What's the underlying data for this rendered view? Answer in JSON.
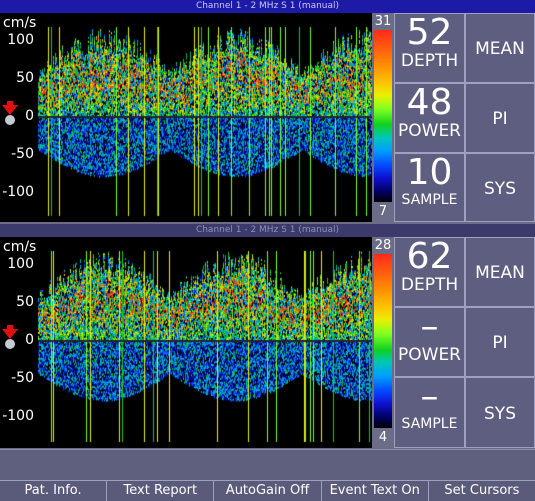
{
  "channels": [
    {
      "title": "Channel 1  -  2 MHz  S 1 (manual)",
      "unit": "cm/s",
      "ticks": [
        "100",
        "50",
        "0",
        "-50",
        "-100"
      ],
      "colorbar_top": "31",
      "colorbar_bottom": "7",
      "readouts": [
        {
          "value": "52",
          "label": "DEPTH",
          "mode": "MEAN"
        },
        {
          "value": "48",
          "label": "POWER",
          "mode": "PI"
        },
        {
          "value": "10",
          "label": "SAMPLE",
          "mode": "SYS"
        }
      ]
    },
    {
      "title": "Channel 1  -  2 MHz  S 1 (manual)",
      "unit": "cm/s",
      "ticks": [
        "100",
        "50",
        "0",
        "-50",
        "-100"
      ],
      "colorbar_top": "28",
      "colorbar_bottom": "4",
      "readouts": [
        {
          "value": "62",
          "label": "DEPTH",
          "mode": "MEAN"
        },
        {
          "value": "–",
          "label": "POWER",
          "mode": "PI"
        },
        {
          "value": "–",
          "label": "SAMPLE",
          "mode": "SYS"
        }
      ]
    }
  ],
  "menu": [
    "Pat. Info.",
    "Text Report",
    "AutoGain Off",
    "Event Text On",
    "Set Cursors"
  ],
  "colors": {
    "title_active": "#1d1aa8",
    "title_inactive": "#3b3a6a",
    "panel": "#5e5f80",
    "background": "#6b6c88"
  }
}
